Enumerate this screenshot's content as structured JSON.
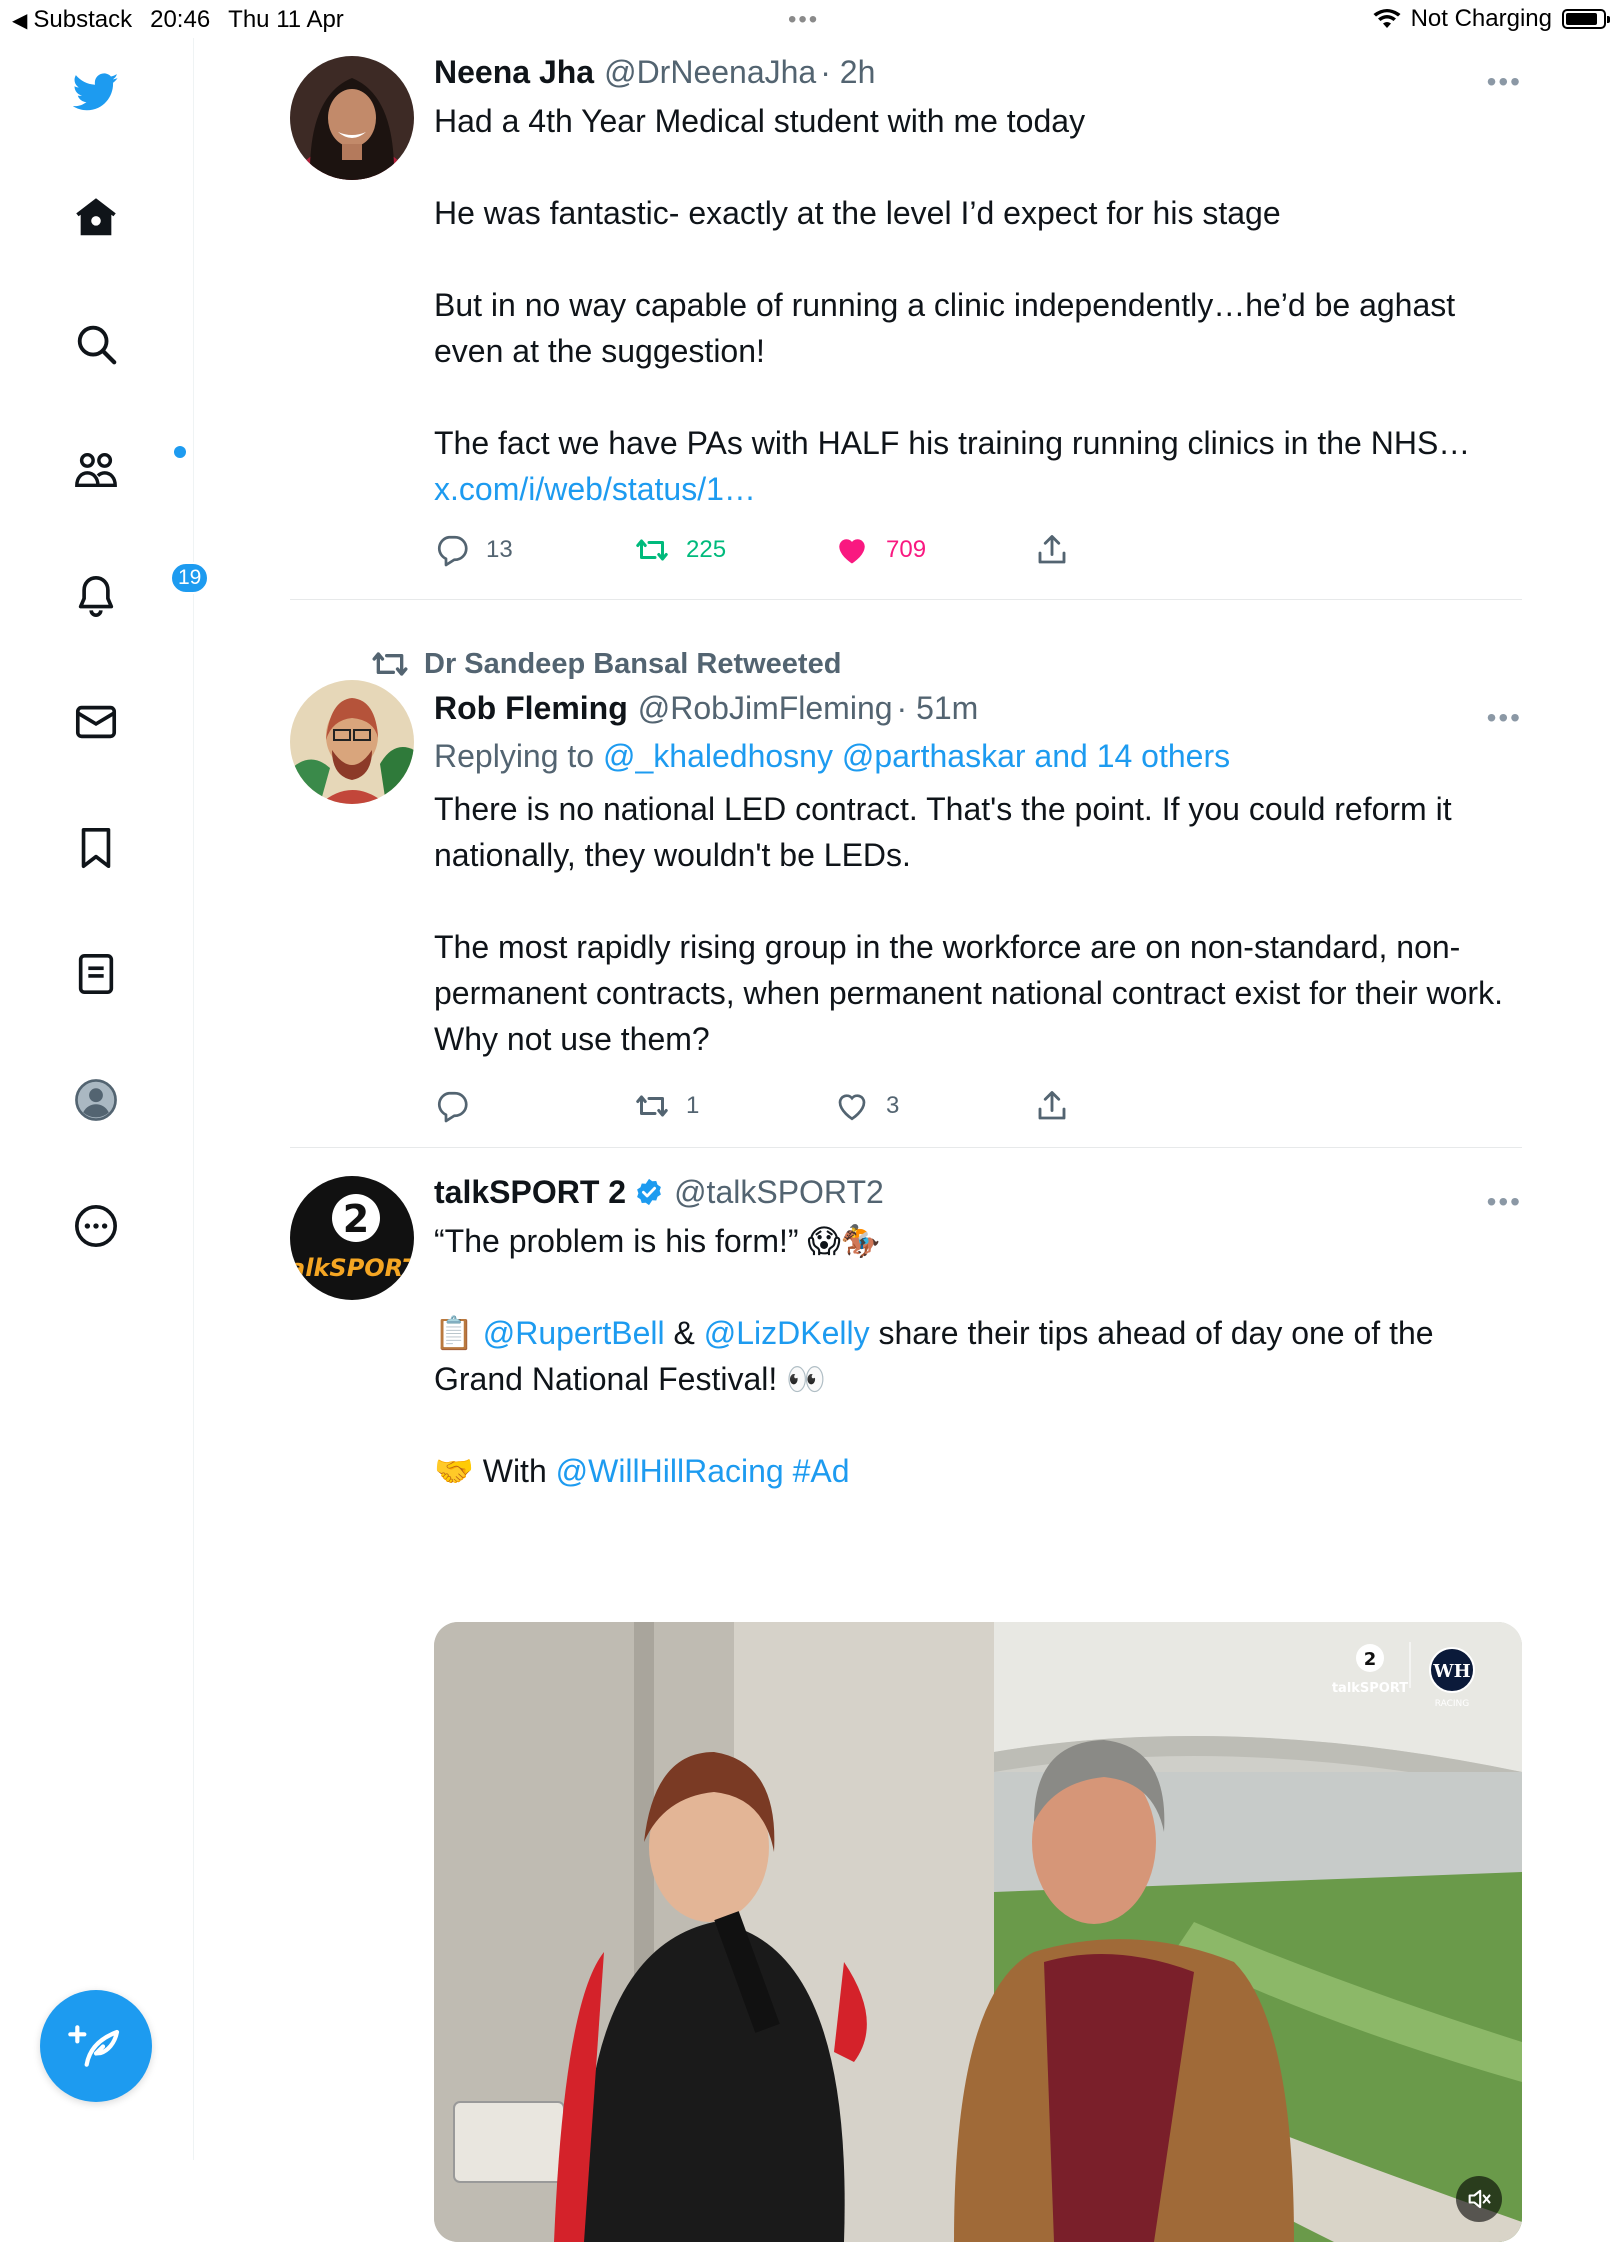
{
  "status_bar": {
    "back_app": "Substack",
    "time": "20:46",
    "date": "Thu 11 Apr",
    "charging": "Not Charging",
    "battery_level": 0.85
  },
  "sidebar": {
    "items": [
      {
        "name": "home",
        "icon": "home-icon"
      },
      {
        "name": "explore",
        "icon": "search-icon"
      },
      {
        "name": "communities",
        "icon": "people-icon",
        "dot": true
      },
      {
        "name": "notifications",
        "icon": "bell-icon",
        "badge": "19"
      },
      {
        "name": "messages",
        "icon": "envelope-icon"
      },
      {
        "name": "bookmarks",
        "icon": "bookmark-icon"
      },
      {
        "name": "lists",
        "icon": "list-icon"
      },
      {
        "name": "profile",
        "icon": "profile-icon"
      },
      {
        "name": "more",
        "icon": "more-circle-icon"
      }
    ],
    "compose_icon": "compose-feather-icon"
  },
  "tweets": [
    {
      "name": "Neena Jha",
      "handle": "@DrNeenaJha",
      "time": "· 2h",
      "text": "Had a 4th Year Medical student with me today\n\nHe was fantastic- exactly at the level I’d expect for his stage\n\nBut in no way capable of running a clinic independently…he’d be aghast even at the suggestion!\n\nThe fact we have PAs with HALF his training running clinics in the NHS… ",
      "link": "x.com/i/web/status/1…",
      "replies": "13",
      "retweets": "225",
      "likes": "709",
      "retweeted": true,
      "liked": true
    },
    {
      "social_context": "Dr Sandeep Bansal Retweeted",
      "name": "Rob Fleming",
      "handle": "@RobJimFleming",
      "time": "· 51m",
      "replying_prefix": "Replying to ",
      "replying_to": "@_khaledhosny @parthaskar and 14 others",
      "text": "There is no national LED contract. That's the point. If you could reform it nationally, they wouldn't be LEDs.\n\nThe most rapidly rising group in the workforce are on non-standard, non-permanent contracts, when permanent national contract exist for their work. Why not use them?",
      "replies": "",
      "retweets": "1",
      "likes": "3"
    },
    {
      "name": "talkSPORT 2",
      "verified": true,
      "handle": "@talkSPORT2",
      "line1": "“The problem is his form!” 😱🏇",
      "clipboard": "📋 ",
      "mention1": "@RupertBell",
      "amp": " & ",
      "mention2": "@LizDKelly",
      "line2_rest": " share their tips ahead of day one of the Grand National Festival! 👀",
      "handshake": "🤝 With ",
      "mention3": "@WillHillRacing",
      "hashtag": " #Ad",
      "video_logo_1": "talkSPORT",
      "video_logo_2": "RACING"
    }
  ],
  "colors": {
    "accent": "#1d9bf0",
    "retweet_green": "#00ba7c",
    "like_pink": "#f91880",
    "secondary": "#536471"
  }
}
